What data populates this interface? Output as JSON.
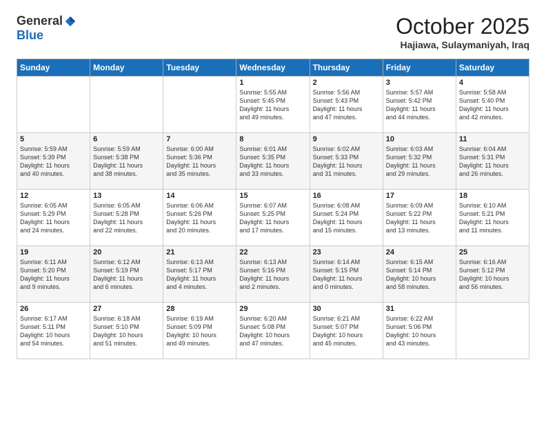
{
  "header": {
    "logo_general": "General",
    "logo_blue": "Blue",
    "month": "October 2025",
    "location": "Hajiawa, Sulaymaniyah, Iraq"
  },
  "weekdays": [
    "Sunday",
    "Monday",
    "Tuesday",
    "Wednesday",
    "Thursday",
    "Friday",
    "Saturday"
  ],
  "weeks": [
    [
      {
        "day": "",
        "info": ""
      },
      {
        "day": "",
        "info": ""
      },
      {
        "day": "",
        "info": ""
      },
      {
        "day": "1",
        "info": "Sunrise: 5:55 AM\nSunset: 5:45 PM\nDaylight: 11 hours\nand 49 minutes."
      },
      {
        "day": "2",
        "info": "Sunrise: 5:56 AM\nSunset: 5:43 PM\nDaylight: 11 hours\nand 47 minutes."
      },
      {
        "day": "3",
        "info": "Sunrise: 5:57 AM\nSunset: 5:42 PM\nDaylight: 11 hours\nand 44 minutes."
      },
      {
        "day": "4",
        "info": "Sunrise: 5:58 AM\nSunset: 5:40 PM\nDaylight: 11 hours\nand 42 minutes."
      }
    ],
    [
      {
        "day": "5",
        "info": "Sunrise: 5:59 AM\nSunset: 5:39 PM\nDaylight: 11 hours\nand 40 minutes."
      },
      {
        "day": "6",
        "info": "Sunrise: 5:59 AM\nSunset: 5:38 PM\nDaylight: 11 hours\nand 38 minutes."
      },
      {
        "day": "7",
        "info": "Sunrise: 6:00 AM\nSunset: 5:36 PM\nDaylight: 11 hours\nand 35 minutes."
      },
      {
        "day": "8",
        "info": "Sunrise: 6:01 AM\nSunset: 5:35 PM\nDaylight: 11 hours\nand 33 minutes."
      },
      {
        "day": "9",
        "info": "Sunrise: 6:02 AM\nSunset: 5:33 PM\nDaylight: 11 hours\nand 31 minutes."
      },
      {
        "day": "10",
        "info": "Sunrise: 6:03 AM\nSunset: 5:32 PM\nDaylight: 11 hours\nand 29 minutes."
      },
      {
        "day": "11",
        "info": "Sunrise: 6:04 AM\nSunset: 5:31 PM\nDaylight: 11 hours\nand 26 minutes."
      }
    ],
    [
      {
        "day": "12",
        "info": "Sunrise: 6:05 AM\nSunset: 5:29 PM\nDaylight: 11 hours\nand 24 minutes."
      },
      {
        "day": "13",
        "info": "Sunrise: 6:05 AM\nSunset: 5:28 PM\nDaylight: 11 hours\nand 22 minutes."
      },
      {
        "day": "14",
        "info": "Sunrise: 6:06 AM\nSunset: 5:26 PM\nDaylight: 11 hours\nand 20 minutes."
      },
      {
        "day": "15",
        "info": "Sunrise: 6:07 AM\nSunset: 5:25 PM\nDaylight: 11 hours\nand 17 minutes."
      },
      {
        "day": "16",
        "info": "Sunrise: 6:08 AM\nSunset: 5:24 PM\nDaylight: 11 hours\nand 15 minutes."
      },
      {
        "day": "17",
        "info": "Sunrise: 6:09 AM\nSunset: 5:22 PM\nDaylight: 11 hours\nand 13 minutes."
      },
      {
        "day": "18",
        "info": "Sunrise: 6:10 AM\nSunset: 5:21 PM\nDaylight: 11 hours\nand 11 minutes."
      }
    ],
    [
      {
        "day": "19",
        "info": "Sunrise: 6:11 AM\nSunset: 5:20 PM\nDaylight: 11 hours\nand 9 minutes."
      },
      {
        "day": "20",
        "info": "Sunrise: 6:12 AM\nSunset: 5:19 PM\nDaylight: 11 hours\nand 6 minutes."
      },
      {
        "day": "21",
        "info": "Sunrise: 6:13 AM\nSunset: 5:17 PM\nDaylight: 11 hours\nand 4 minutes."
      },
      {
        "day": "22",
        "info": "Sunrise: 6:13 AM\nSunset: 5:16 PM\nDaylight: 11 hours\nand 2 minutes."
      },
      {
        "day": "23",
        "info": "Sunrise: 6:14 AM\nSunset: 5:15 PM\nDaylight: 11 hours\nand 0 minutes."
      },
      {
        "day": "24",
        "info": "Sunrise: 6:15 AM\nSunset: 5:14 PM\nDaylight: 10 hours\nand 58 minutes."
      },
      {
        "day": "25",
        "info": "Sunrise: 6:16 AM\nSunset: 5:12 PM\nDaylight: 10 hours\nand 56 minutes."
      }
    ],
    [
      {
        "day": "26",
        "info": "Sunrise: 6:17 AM\nSunset: 5:11 PM\nDaylight: 10 hours\nand 54 minutes."
      },
      {
        "day": "27",
        "info": "Sunrise: 6:18 AM\nSunset: 5:10 PM\nDaylight: 10 hours\nand 51 minutes."
      },
      {
        "day": "28",
        "info": "Sunrise: 6:19 AM\nSunset: 5:09 PM\nDaylight: 10 hours\nand 49 minutes."
      },
      {
        "day": "29",
        "info": "Sunrise: 6:20 AM\nSunset: 5:08 PM\nDaylight: 10 hours\nand 47 minutes."
      },
      {
        "day": "30",
        "info": "Sunrise: 6:21 AM\nSunset: 5:07 PM\nDaylight: 10 hours\nand 45 minutes."
      },
      {
        "day": "31",
        "info": "Sunrise: 6:22 AM\nSunset: 5:06 PM\nDaylight: 10 hours\nand 43 minutes."
      },
      {
        "day": "",
        "info": ""
      }
    ]
  ]
}
